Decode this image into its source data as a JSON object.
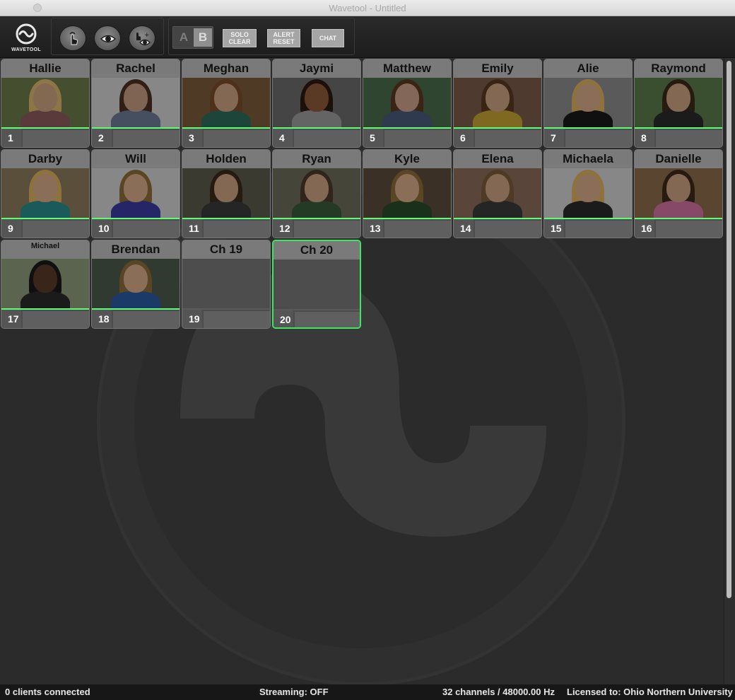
{
  "window": {
    "title": "Wavetool - Untitled"
  },
  "toolbar": {
    "logo_label": "WAVETOOL",
    "a_label": "A",
    "b_label": "B",
    "solo_clear_label": "SOLO\nCLEAR",
    "alert_reset_label": "ALERT\nRESET",
    "chat_label": "CHAT"
  },
  "channels": [
    {
      "name": "Hallie",
      "num": "1",
      "photo": true,
      "skin": "#c9a27e",
      "hair": "#d9b56b",
      "shirt": "#8a5a5a",
      "bg": "#6b7a4a",
      "meter": true
    },
    {
      "name": "Rachel",
      "num": "2",
      "photo": true,
      "skin": "#c49a80",
      "hair": "#4a3020",
      "shirt": "#6a7a94",
      "bg": "#cfcfcf",
      "meter": true
    },
    {
      "name": "Meghan",
      "num": "3",
      "photo": true,
      "skin": "#c9a080",
      "hair": "#7a4a2a",
      "shirt": "#2e6a5a",
      "bg": "#7a5a3a",
      "meter": true
    },
    {
      "name": "Jaymi",
      "num": "4",
      "photo": true,
      "skin": "#8a5a3a",
      "hair": "#2a1a10",
      "shirt": "#9a9a9a",
      "bg": "#6a6a6a",
      "meter": true
    },
    {
      "name": "Matthew",
      "num": "5",
      "photo": true,
      "skin": "#caa08a",
      "hair": "#5a3a20",
      "shirt": "#4a5a7a",
      "bg": "#4a6a4a",
      "meter": true
    },
    {
      "name": "Emily",
      "num": "6",
      "photo": true,
      "skin": "#c9a080",
      "hair": "#5a3a20",
      "shirt": "#c4a030",
      "bg": "#7a5a4a",
      "meter": true
    },
    {
      "name": "Alie",
      "num": "7",
      "photo": true,
      "skin": "#d4aa88",
      "hair": "#d9b060",
      "shirt": "#1a1a1a",
      "bg": "#8a8a8a",
      "meter": true
    },
    {
      "name": "Raymond",
      "num": "8",
      "photo": true,
      "skin": "#c9a080",
      "hair": "#3a2a1a",
      "shirt": "#2a2a2a",
      "bg": "#5a7a4a",
      "meter": true
    },
    {
      "name": "Darby",
      "num": "9",
      "photo": true,
      "skin": "#d4aa88",
      "hair": "#d9b060",
      "shirt": "#2a8a8a",
      "bg": "#8a7a5a",
      "meter": true
    },
    {
      "name": "Will",
      "num": "10",
      "photo": true,
      "skin": "#d4aa88",
      "hair": "#8a6a3a",
      "shirt": "#3a3aa0",
      "bg": "#d0d0d0",
      "meter": true
    },
    {
      "name": "Holden",
      "num": "11",
      "photo": true,
      "skin": "#c9a080",
      "hair": "#3a2a1a",
      "shirt": "#3a3a3a",
      "bg": "#5a5a4a",
      "meter": true
    },
    {
      "name": "Ryan",
      "num": "12",
      "photo": true,
      "skin": "#c9a080",
      "hair": "#4a3a2a",
      "shirt": "#3a5a3a",
      "bg": "#6a6a5a",
      "meter": true
    },
    {
      "name": "Kyle",
      "num": "13",
      "photo": true,
      "skin": "#d4aa88",
      "hair": "#8a6a3a",
      "shirt": "#2a4a2a",
      "bg": "#5a4a3a",
      "meter": true
    },
    {
      "name": "Elena",
      "num": "14",
      "photo": true,
      "skin": "#c9a080",
      "hair": "#7a5a3a",
      "shirt": "#3a3a3a",
      "bg": "#8a6a5a",
      "meter": true
    },
    {
      "name": "Michaela",
      "num": "15",
      "photo": true,
      "skin": "#d4aa88",
      "hair": "#d9b060",
      "shirt": "#2a2a2a",
      "bg": "#d0d0d0",
      "meter": true
    },
    {
      "name": "Danielle",
      "num": "16",
      "photo": true,
      "skin": "#c9a080",
      "hair": "#3a2a1a",
      "shirt": "#d070a0",
      "bg": "#8a6a4a",
      "meter": true
    },
    {
      "name": "Michael",
      "num": "17",
      "photo": true,
      "skin": "#5a3a2a",
      "hair": "#1a1a1a",
      "shirt": "#2a2a2a",
      "bg": "#8a9a7a",
      "meter": true,
      "small": true
    },
    {
      "name": "Brendan",
      "num": "18",
      "photo": true,
      "skin": "#d4aa88",
      "hair": "#8a6a3a",
      "shirt": "#2a5aa0",
      "bg": "#4a5a4a",
      "meter": true
    },
    {
      "name": "Ch 19",
      "num": "19",
      "photo": false,
      "meter": false
    },
    {
      "name": "Ch 20",
      "num": "20",
      "photo": false,
      "meter": false,
      "selected": true
    }
  ],
  "status": {
    "clients": "0 clients connected",
    "streaming": "Streaming: OFF",
    "channels_info": "32 channels / 48000.00 Hz",
    "license": "Licensed to: Ohio Northern University"
  },
  "colors": {
    "meter_green": "#5cff73",
    "selected_border": "#3bea5c"
  },
  "icons": [
    "wavetool-logo-icon",
    "touch-icon",
    "eye-icon",
    "touch-eye-icon"
  ]
}
